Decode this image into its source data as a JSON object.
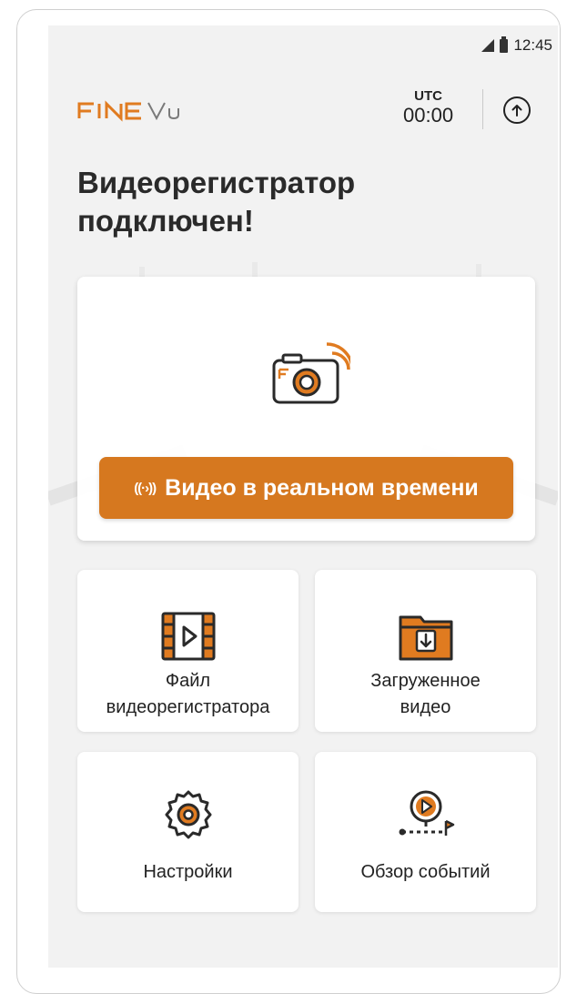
{
  "status_bar": {
    "time": "12:45"
  },
  "header": {
    "brand": "FINE Vu",
    "utc_label": "UTC",
    "utc_time": "00:00",
    "upload_icon": "arrow-up-circle-icon"
  },
  "title": "Видеорегистратор\nподключен!",
  "live": {
    "icon_text": "((·›))",
    "label": "Видео в реальном времени"
  },
  "tiles": [
    {
      "label": "Файл\nвидеорегистратора",
      "icon": "film-play-icon"
    },
    {
      "label": "Загруженное\nвидео",
      "icon": "folder-download-icon"
    },
    {
      "label": "Настройки",
      "icon": "gear-icon"
    },
    {
      "label": "Обзор событий",
      "icon": "event-route-icon"
    }
  ],
  "colors": {
    "accent": "#d6781f",
    "background": "#f2f2f2",
    "text": "#222222"
  }
}
